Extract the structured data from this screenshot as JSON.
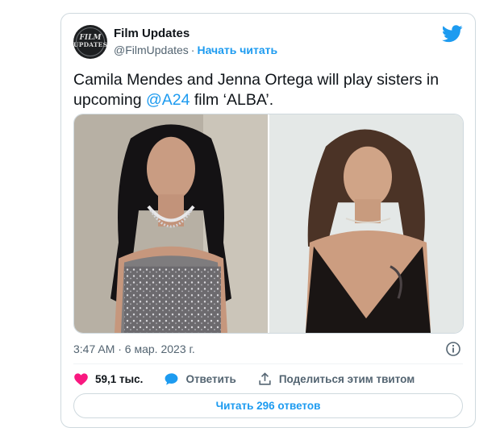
{
  "author": {
    "name": "Film Updates",
    "handle": "@FilmUpdates",
    "separator": "·",
    "follow_label": "Начать читать",
    "avatar_text_top": "FILM",
    "avatar_text_bottom": "UPDATES"
  },
  "tweet": {
    "text_before": "Camila Mendes and Jenna Ortega will play sisters in upcoming ",
    "mention": "@A24",
    "text_after": " film ‘ALBA’.",
    "timestamp": "3:47 AM · 6 мар. 2023 г."
  },
  "actions": {
    "likes": "59,1 тыс.",
    "reply_label": "Ответить",
    "share_label": "Поделиться этим твитом"
  },
  "read_replies_label": "Читать 296 ответов",
  "icons": {
    "brand": "twitter-bird-icon",
    "info": "info-icon",
    "like": "heart-icon",
    "reply": "speech-bubble-icon",
    "share": "share-upload-icon"
  },
  "colors": {
    "accent": "#1d9bf0",
    "like": "#f91880",
    "text": "#0f1419",
    "muted": "#536471",
    "border": "#cfd9de"
  }
}
